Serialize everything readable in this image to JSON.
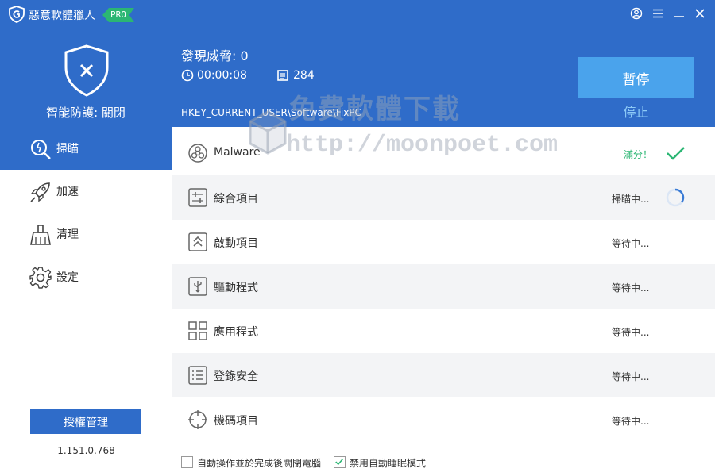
{
  "titlebar": {
    "app_title": "惡意軟體獵人",
    "badge": "PRO",
    "icons": [
      "app-logo-icon",
      "user-icon",
      "menu-icon",
      "minimize-icon",
      "close-icon"
    ]
  },
  "status_panel": {
    "protect_label": "智能防護: 關閉",
    "threats_label": "發現威脅: 0",
    "elapsed_time": "00:00:08",
    "scanned_count": "284",
    "current_path": "HKEY_CURRENT_USER\\Software\\FixPC",
    "pause_label": "暫停",
    "stop_label": "停止"
  },
  "watermark": {
    "line1": "免費軟體下載",
    "line2": "http://moonpoet.com"
  },
  "sidebar": {
    "items": [
      {
        "label": "掃瞄",
        "icon": "scan-icon",
        "active": true
      },
      {
        "label": "加速",
        "icon": "rocket-icon",
        "active": false
      },
      {
        "label": "清理",
        "icon": "broom-icon",
        "active": false
      },
      {
        "label": "設定",
        "icon": "gear-icon",
        "active": false
      }
    ],
    "license_label": "授權管理",
    "version": "1.151.0.768"
  },
  "scan_items": [
    {
      "label": "Malware",
      "status": "滿分！",
      "icon": "biohazard-icon",
      "indicator": "check-icon"
    },
    {
      "label": "綜合項目",
      "status": "掃瞄中...",
      "icon": "sliders-icon",
      "indicator": "spinner-icon"
    },
    {
      "label": "啟動項目",
      "status": "等待中...",
      "icon": "startup-icon",
      "indicator": ""
    },
    {
      "label": "驅動程式",
      "status": "等待中...",
      "icon": "usb-icon",
      "indicator": ""
    },
    {
      "label": "應用程式",
      "status": "等待中...",
      "icon": "apps-grid-icon",
      "indicator": ""
    },
    {
      "label": "登錄安全",
      "status": "等待中...",
      "icon": "registry-list-icon",
      "indicator": ""
    },
    {
      "label": "機碼項目",
      "status": "等待中...",
      "icon": "crosshair-icon",
      "indicator": ""
    }
  ],
  "footer": {
    "shutdown_label": "自動操作並於完成後關閉電腦",
    "shutdown_checked": false,
    "nosleep_label": "禁用自動睡眠模式",
    "nosleep_checked": true
  },
  "colors": {
    "header_blue": "#2f6cc9",
    "accent_light_blue": "#4aa3ec",
    "success_green": "#2bb673",
    "row_alt": "#f3f4f6"
  }
}
